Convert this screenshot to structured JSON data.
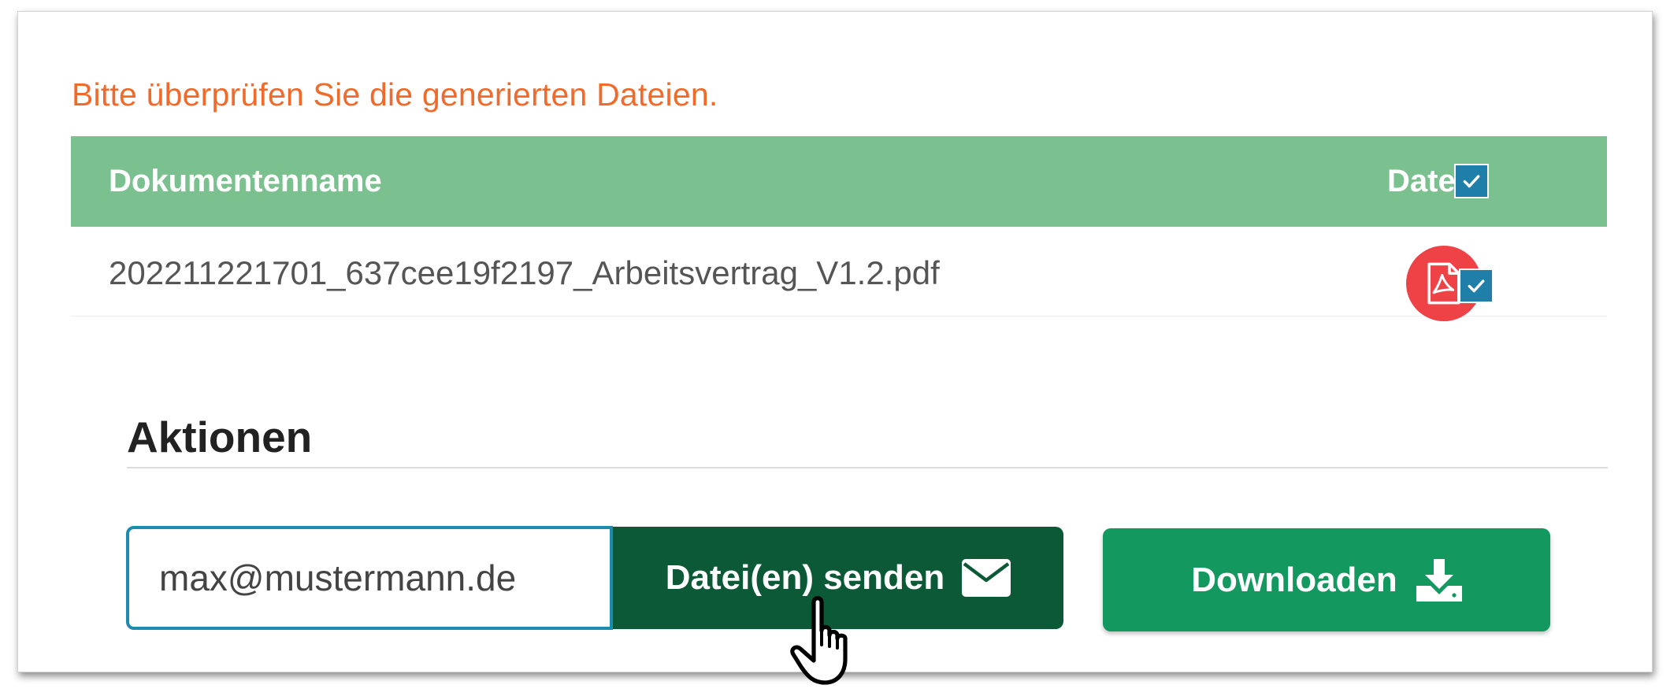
{
  "notice": "Bitte überprüfen Sie die generierten Dateien.",
  "table": {
    "headers": {
      "name": "Dokumentenname",
      "file": "Datei"
    },
    "header_checkbox_checked": true,
    "rows": [
      {
        "name": "202211221701_637cee19f2197_Arbeitsvertrag_V1.2.pdf",
        "file_icon": "pdf-icon",
        "checked": true
      }
    ]
  },
  "actions": {
    "title": "Aktionen",
    "email_value": "max@mustermann.de",
    "send_label": "Datei(en) senden",
    "send_icon": "envelope-icon",
    "download_label": "Downloaden",
    "download_icon": "download-icon"
  },
  "colors": {
    "notice": "#f06a2b",
    "table_header": "#7bc18f",
    "checkbox": "#1f7fa8",
    "pdf_button": "#ee4246",
    "input_border": "#1b8cb0",
    "send_button": "#0b5936",
    "download_button": "#13985f"
  }
}
